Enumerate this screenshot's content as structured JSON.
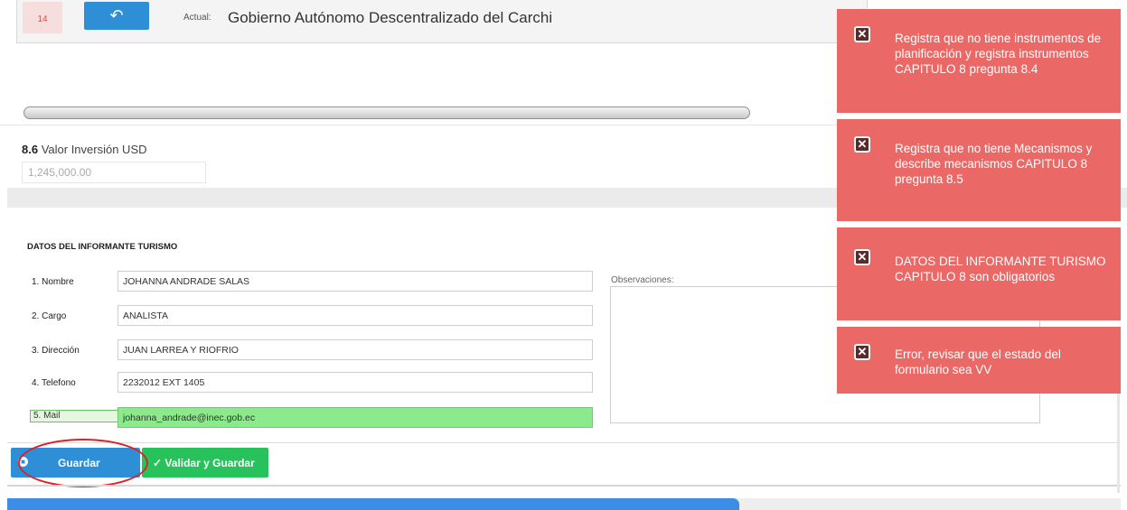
{
  "header": {
    "row_number": "14",
    "back_icon": "reply-arrow-icon",
    "actual_label": "Actual:",
    "actual_value": "Gobierno Autónomo Descentralizado del Carchi"
  },
  "investment": {
    "number": "8.6",
    "label": "Valor Inversión USD",
    "value": "1,245,000.00"
  },
  "informant": {
    "section_title": "DATOS DEL INFORMANTE TURISMO",
    "fields": [
      {
        "label": "1. Nombre",
        "value": "JOHANNA ANDRADE SALAS"
      },
      {
        "label": "2. Cargo",
        "value": "ANALISTA"
      },
      {
        "label": "3. Dirección",
        "value": "JUAN LARREA Y RIOFRIO"
      },
      {
        "label": "4. Telefono",
        "value": "2232012 EXT 1405"
      },
      {
        "label": "5. Mail",
        "value": "johanna_andrade@inec.gob.ec"
      }
    ],
    "observations_label": "Observaciones:",
    "observations_value": ""
  },
  "actions": {
    "save_label": "Guardar",
    "validate_label": "✓ Validar y Guardar"
  },
  "notifications": [
    {
      "message": "Registra que no tiene instrumentos de planificación y registra instrumentos CAPITULO 8 pregunta 8.4"
    },
    {
      "message": "Registra que no tiene Mecanismos y describe mecanismos CAPITULO 8 pregunta 8.5"
    },
    {
      "message": "DATOS DEL INFORMANTE TURISMO CAPITULO 8 son obligatorios"
    },
    {
      "message": "Error, revisar que el estado del formulario sea VV"
    }
  ],
  "colors": {
    "primary_blue": "#2e8fd6",
    "success_green": "#28c25c",
    "toast_red": "#ea6865",
    "mail_highlight": "#8ce98c",
    "annotation_red": "#d8232a"
  }
}
